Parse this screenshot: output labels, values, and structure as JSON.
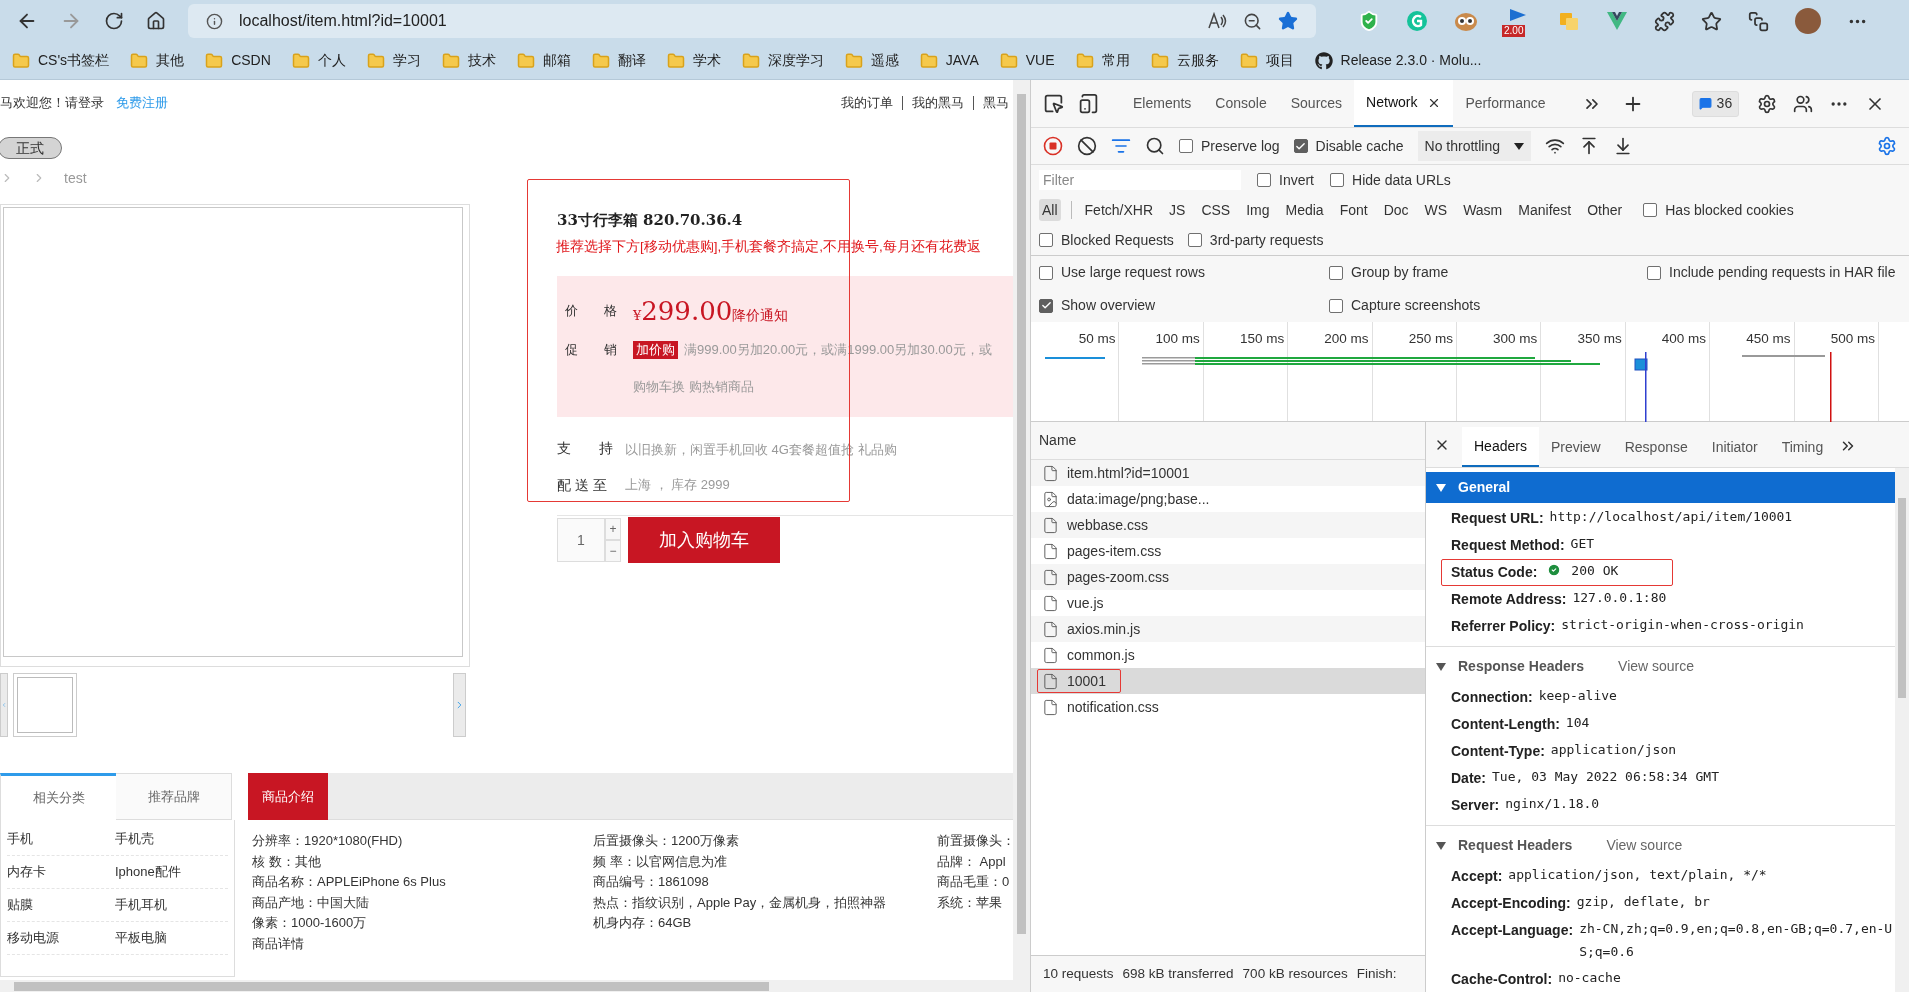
{
  "browser": {
    "address": "localhost/item.html?id=10001",
    "extension_badge": "2.00",
    "bookmarks": [
      {
        "kind": "folder",
        "label": "CS's书签栏"
      },
      {
        "kind": "folder",
        "label": "其他"
      },
      {
        "kind": "folder",
        "label": "CSDN"
      },
      {
        "kind": "folder",
        "label": "个人"
      },
      {
        "kind": "folder",
        "label": "学习"
      },
      {
        "kind": "folder",
        "label": "技术"
      },
      {
        "kind": "folder",
        "label": "邮箱"
      },
      {
        "kind": "folder",
        "label": "翻译"
      },
      {
        "kind": "folder",
        "label": "学术"
      },
      {
        "kind": "folder",
        "label": "深度学习"
      },
      {
        "kind": "folder",
        "label": "遥感"
      },
      {
        "kind": "folder",
        "label": "JAVA"
      },
      {
        "kind": "folder",
        "label": "VUE"
      },
      {
        "kind": "folder",
        "label": "常用"
      },
      {
        "kind": "folder",
        "label": "云服务"
      },
      {
        "kind": "folder",
        "label": "项目"
      },
      {
        "kind": "github",
        "label": "Release 2.3.0 · Molu..."
      }
    ]
  },
  "page": {
    "top_bar": {
      "welcome": "马欢迎您！请登录",
      "register": "免费注册",
      "links": [
        "我的订单",
        "我的黑马",
        "黑马"
      ]
    },
    "env_button": "正式",
    "breadcrumb": [
      "test"
    ],
    "product": {
      "outlined": true,
      "title": "33寸行李箱 820.70.36.4",
      "promo_note": "推荐选择下方[移动优惠购],手机套餐齐搞定,不用换号,每月还有花费返",
      "price_label": "价　　格",
      "currency": "¥",
      "price": "299.00",
      "price_notice": "降价通知",
      "promo_label": "促　　销",
      "promo_badge": "加价购",
      "promo_text": "满999.00另加20.00元，或满1999.00另加30.00元，或",
      "promo_text_2": "购物车换 购热销商品",
      "support_label": "支　　持",
      "support_text": "以旧换新，闲置手机回收 4G套餐超值抢 礼品购",
      "delivery_label": "配 送 至",
      "delivery_text": "上海 ， 库存 2999"
    },
    "quantity": "1",
    "plus": "+",
    "minus": "−",
    "add_to_cart": "加入购物车",
    "category_tabs": [
      {
        "label": "相关分类",
        "selected": true
      },
      {
        "label": "推荐品牌",
        "selected": false
      }
    ],
    "categories": [
      [
        "手机",
        "手机壳"
      ],
      [
        "内存卡",
        "Iphone配件"
      ],
      [
        "贴膜",
        "手机耳机"
      ],
      [
        "移动电源",
        "平板电脑"
      ]
    ],
    "detail_tab": "商品介绍",
    "specs": [
      [
        "分辨率：1920*1080(FHD)",
        "核 数：其他",
        "商品名称：APPLEiPhone 6s Plus",
        "商品产地：中国大陆",
        "像素：1000-1600万",
        "商品详情"
      ],
      [
        "后置摄像头：1200万像素",
        "频 率：以官网信息为准",
        "商品编号：1861098",
        "热点：指纹识别，Apple Pay，金属机身，拍照神器",
        "机身内存：64GB"
      ],
      [
        "前置摄像头：",
        "品牌： Appl",
        "商品毛重：0",
        "系统：苹果"
      ]
    ]
  },
  "devtools": {
    "tabs": [
      {
        "label": "Elements",
        "selected": false
      },
      {
        "label": "Console",
        "selected": false
      },
      {
        "label": "Sources",
        "selected": false
      },
      {
        "label": "Network",
        "selected": true
      },
      {
        "label": "Performance",
        "selected": false
      }
    ],
    "issues_count": "36",
    "preserve_log": {
      "label": "Preserve log",
      "checked": false
    },
    "disable_cache": {
      "label": "Disable cache",
      "checked": true
    },
    "throttling": "No throttling",
    "filter_placeholder": "Filter",
    "filter_options": [
      {
        "label": "Invert",
        "checked": false
      },
      {
        "label": "Hide data URLs",
        "checked": false
      }
    ],
    "types": [
      {
        "label": "All",
        "selected": true
      },
      {
        "label": "Fetch/XHR",
        "selected": false
      },
      {
        "label": "JS",
        "selected": false
      },
      {
        "label": "CSS",
        "selected": false
      },
      {
        "label": "Img",
        "selected": false
      },
      {
        "label": "Media",
        "selected": false
      },
      {
        "label": "Font",
        "selected": false
      },
      {
        "label": "Doc",
        "selected": false
      },
      {
        "label": "WS",
        "selected": false
      },
      {
        "label": "Wasm",
        "selected": false
      },
      {
        "label": "Manifest",
        "selected": false
      },
      {
        "label": "Other",
        "selected": false
      }
    ],
    "has_blocked_cookies": {
      "label": "Has blocked cookies",
      "checked": false
    },
    "blocked_options": [
      {
        "label": "Blocked Requests",
        "checked": false
      },
      {
        "label": "3rd-party requests",
        "checked": false
      }
    ],
    "settings": [
      {
        "label": "Use large request rows",
        "checked": false
      },
      {
        "label": "Group by frame",
        "checked": false
      },
      {
        "label": "Include pending requests in HAR file",
        "checked": false
      },
      {
        "label": "Show overview",
        "checked": true
      },
      {
        "label": "Capture screenshots",
        "checked": false
      }
    ],
    "overview_ticks": [
      "50 ms",
      "100 ms",
      "150 ms",
      "200 ms",
      "250 ms",
      "300 ms",
      "350 ms",
      "400 ms",
      "450 ms",
      "500 ms"
    ],
    "name_header": "Name",
    "requests": [
      {
        "name": "item.html?id=10001",
        "kind": "document",
        "selected": false,
        "outlined": false
      },
      {
        "name": "data:image/png;base...",
        "kind": "image",
        "selected": false,
        "outlined": false
      },
      {
        "name": "webbase.css",
        "kind": "document",
        "selected": false,
        "outlined": false
      },
      {
        "name": "pages-item.css",
        "kind": "document",
        "selected": false,
        "outlined": false
      },
      {
        "name": "pages-zoom.css",
        "kind": "document",
        "selected": false,
        "outlined": false
      },
      {
        "name": "vue.js",
        "kind": "document",
        "selected": false,
        "outlined": false
      },
      {
        "name": "axios.min.js",
        "kind": "document",
        "selected": false,
        "outlined": false
      },
      {
        "name": "common.js",
        "kind": "document",
        "selected": false,
        "outlined": false
      },
      {
        "name": "10001",
        "kind": "document",
        "selected": true,
        "outlined": true
      },
      {
        "name": "notification.css",
        "kind": "document",
        "selected": false,
        "outlined": false
      }
    ],
    "summary": [
      "10 requests",
      "698 kB transferred",
      "700 kB resources",
      "Finish:"
    ],
    "detail_tabs": [
      {
        "label": "Headers",
        "selected": true
      },
      {
        "label": "Preview",
        "selected": false
      },
      {
        "label": "Response",
        "selected": false
      },
      {
        "label": "Initiator",
        "selected": false
      },
      {
        "label": "Timing",
        "selected": false
      }
    ],
    "sections": [
      {
        "title": "General",
        "expanded": true,
        "selected": true,
        "rows": [
          {
            "key": "Request URL:",
            "value": "http://localhost/api/item/10001",
            "kind": "text",
            "outlined": false
          },
          {
            "key": "Request Method:",
            "value": "GET",
            "kind": "text",
            "outlined": false
          },
          {
            "key": "Status Code:",
            "value": "200 OK",
            "kind": "status",
            "outlined": true
          },
          {
            "key": "Remote Address:",
            "value": "127.0.0.1:80",
            "kind": "text",
            "outlined": false
          },
          {
            "key": "Referrer Policy:",
            "value": "strict-origin-when-cross-origin",
            "kind": "text",
            "outlined": false
          }
        ]
      },
      {
        "title": "Response Headers",
        "view_source": "View source",
        "expanded": true,
        "selected": false,
        "rows": [
          {
            "key": "Connection:",
            "value": "keep-alive",
            "kind": "text",
            "outlined": false
          },
          {
            "key": "Content-Length:",
            "value": "104",
            "kind": "text",
            "outlined": false
          },
          {
            "key": "Content-Type:",
            "value": "application/json",
            "kind": "text",
            "outlined": false
          },
          {
            "key": "Date:",
            "value": "Tue, 03 May 2022 06:58:34 GMT",
            "kind": "text",
            "outlined": false
          },
          {
            "key": "Server:",
            "value": "nginx/1.18.0",
            "kind": "text",
            "outlined": false
          }
        ]
      },
      {
        "title": "Request Headers",
        "view_source": "View source",
        "expanded": true,
        "selected": false,
        "rows": [
          {
            "key": "Accept:",
            "value": "application/json, text/plain, */*",
            "kind": "text",
            "outlined": false
          },
          {
            "key": "Accept-Encoding:",
            "value": "gzip, deflate, br",
            "kind": "text",
            "outlined": false
          },
          {
            "key": "Accept-Language:",
            "value": "zh-CN,zh;q=0.9,en;q=0.8,en-GB;q=0.7,en-US;q=0.6",
            "kind": "text",
            "outlined": false
          },
          {
            "key": "Cache-Control:",
            "value": "no-cache",
            "kind": "text",
            "outlined": false
          }
        ]
      }
    ]
  }
}
